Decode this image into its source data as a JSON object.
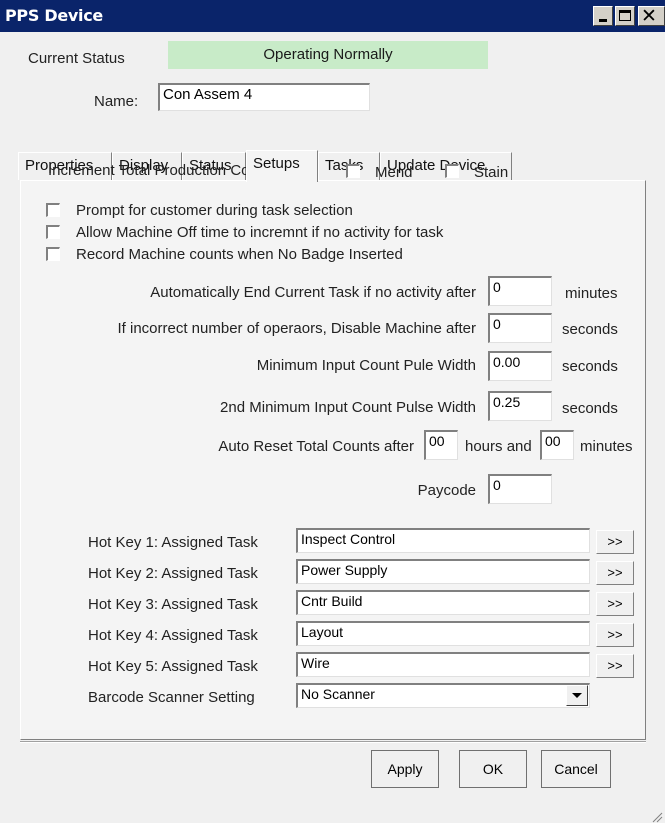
{
  "window": {
    "title": "PPS Device"
  },
  "status": {
    "label": "Current Status",
    "value": "Operating Normally",
    "color": "#c8ebc8"
  },
  "name": {
    "label": "Name:",
    "value": "Con Assem 4"
  },
  "tabs": [
    "Properties",
    "Display",
    "Status",
    "Setups",
    "Tasks",
    "Update Device"
  ],
  "active_tab": "Setups",
  "setups": {
    "increment_label": "Increment Total Production Count on:",
    "mend_label": "Mend",
    "stain_label": "Stain",
    "prompt_label": "Prompt for customer during task selection",
    "allow_off_label": "Allow Machine Off time to incremnt if no activity for task",
    "record_label": "Record Machine counts when No  Badge Inserted",
    "auto_end_label": "Automatically End Current Task if no activity after",
    "auto_end_value": "0",
    "auto_end_unit": "minutes",
    "incorrect_label": "If incorrect number of operaors, Disable Machine after",
    "incorrect_value": "0",
    "incorrect_unit": "seconds",
    "min_pulse_label": "Minimum Input Count Pule Width",
    "min_pulse_value": "0.00",
    "min_pulse_unit": "seconds",
    "min2_pulse_label": "2nd Minimum Input Count Pulse Width",
    "min2_pulse_value": "0.25",
    "min2_pulse_unit": "seconds",
    "auto_reset_label": "Auto Reset Total Counts after",
    "auto_reset_hours": "00",
    "hours_and_label": "hours and",
    "auto_reset_minutes": "00",
    "minutes_label": "minutes",
    "paycode_label": "Paycode",
    "paycode_value": "0",
    "hotkeys": [
      {
        "label": "Hot Key 1: Assigned Task",
        "value": "Inspect Control",
        "btn": ">>"
      },
      {
        "label": "Hot Key 2: Assigned Task",
        "value": "Power Supply",
        "btn": ">>"
      },
      {
        "label": "Hot Key 3: Assigned Task",
        "value": "Cntr Build",
        "btn": ">>"
      },
      {
        "label": "Hot Key 4: Assigned Task",
        "value": "Layout",
        "btn": ">>"
      },
      {
        "label": "Hot Key 5: Assigned Task",
        "value": "Wire",
        "btn": ">>"
      }
    ],
    "barcode_label": "Barcode Scanner Setting",
    "barcode_value": "No Scanner"
  },
  "footer": {
    "apply": "Apply",
    "ok": "OK",
    "cancel": "Cancel"
  },
  "colors": {
    "titlebar": "#0a246a",
    "status_bg": "#c8ebc8",
    "window_bg": "#f0f0f0"
  },
  "icons": {
    "minimize": "minimize-icon",
    "maximize": "maximize-icon",
    "close": "close-icon",
    "dropdown": "chevron-down-icon",
    "resize": "resize-grip-icon"
  }
}
